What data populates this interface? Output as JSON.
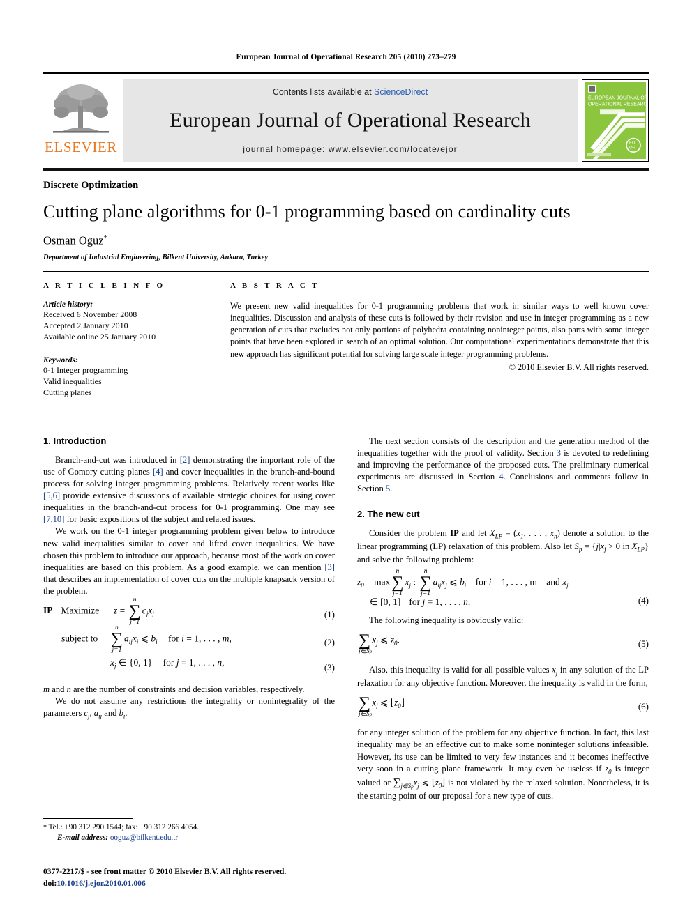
{
  "masthead": {
    "running_head": "European Journal of Operational Research 205 (2010) 273–279"
  },
  "journal_header": {
    "publisher_logo_text": "ELSEVIER",
    "contents_prefix": "Contents lists available at ",
    "contents_link": "ScienceDirect",
    "journal_title": "European Journal of Operational Research",
    "homepage": "journal homepage: www.elsevier.com/locate/ejor",
    "cover_title_line1": "EUROPEAN JOURNAL OF",
    "cover_title_line2": "OPERATIONAL RESEARCH",
    "cover_accent_color": "#8cc63e",
    "link_color": "#2a5db0"
  },
  "article": {
    "section_kind": "Discrete Optimization",
    "title": "Cutting plane algorithms for 0-1 programming based on cardinality cuts",
    "author": "Osman Oguz",
    "author_footnote_marker": "*",
    "affiliation": "Department of Industrial Engineering, Bilkent University, Ankara, Turkey"
  },
  "article_info": {
    "heading": "A R T I C L E    I N F O",
    "history_label": "Article history:",
    "history": [
      "Received 6 November 2008",
      "Accepted 2 January 2010",
      "Available online 25 January 2010"
    ],
    "keywords_label": "Keywords:",
    "keywords": [
      "0-1 Integer programming",
      "Valid inequalities",
      "Cutting planes"
    ]
  },
  "abstract": {
    "heading": "A B S T R A C T",
    "text": "We present new valid inequalities for 0-1 programming problems that work in similar ways to well known cover inequalities. Discussion and analysis of these cuts is followed by their revision and use in integer programming as a new generation of cuts that excludes not only portions of polyhedra containing noninteger points, also parts with some integer points that have been explored in search of an optimal solution. Our computational experimentations demonstrate that this new approach has significant potential for solving large scale integer programming problems.",
    "copyright": "© 2010 Elsevier B.V. All rights reserved."
  },
  "body": {
    "left_column": {
      "section1_heading": "1. Introduction",
      "para1_a": "Branch-and-cut was introduced in ",
      "para1_ref1": "[2]",
      "para1_b": " demonstrating the important role of the use of Gomory cutting planes ",
      "para1_ref2": "[4]",
      "para1_c": " and cover inequalities in the branch-and-bound process for solving integer programming problems. Relatively recent works like ",
      "para1_ref3": "[5,6]",
      "para1_d": " provide extensive discussions of available strategic choices for using cover inequalities in the branch-and-cut process for 0-1 programming. One may see ",
      "para1_ref4": "[7,10]",
      "para1_e": " for basic expositions of the subject and related issues.",
      "para2_a": "We work on the 0-1 integer programming problem given below to introduce new valid inequalities similar to cover and lifted cover inequalities. We have chosen this problem to introduce our approach, because most of the work on cover inequalities are based on this problem. As a good example, we can mention ",
      "para2_ref1": "[3]",
      "para2_b": " that describes an implementation of cover cuts on the multiple knapsack version of the problem.",
      "eq1_label": "IP",
      "eq1_keyword": "Maximize",
      "eq1_number": "(1)",
      "eq2_keyword": "subject to",
      "eq2_number": "(2)",
      "eq3_number": "(3)",
      "para3": "m and n are the number of constraints and decision variables, respectively.",
      "para4": "We do not assume any restrictions the integrality or nonintegrality of the parameters cj, aij and bi."
    },
    "right_column": {
      "para1_a": "The next section consists of the description and the generation method of the inequalities together with the proof of validity. Section ",
      "para1_ref1": "3",
      "para1_b": " is devoted to redefining and improving the performance of the proposed cuts. The preliminary numerical experiments are discussed in Section ",
      "para1_ref2": "4",
      "para1_c": ". Conclusions and comments follow in Section ",
      "para1_ref3": "5",
      "para1_d": ".",
      "section2_heading": "2. The new cut",
      "para2": "Consider the problem IP and let XLP = (x1, . . . , xn) denote a solution to the linear programming (LP) relaxation of this problem. Also let Sp = {j|xj > 0 in XLP} and solve the following problem:",
      "eq4_number": "(4)",
      "para3": "The following inequality is obviously valid:",
      "eq5_number": "(5)",
      "para4": "Also, this inequality is valid for all possible values xj in any solution of the LP relaxation for any objective function. Moreover, the inequality is valid in the form,",
      "eq6_number": "(6)",
      "para5": "for any integer solution of the problem for any objective function. In fact, this last inequality may be an effective cut to make some noninteger solutions infeasible. However, its use can be limited to very few instances and it becomes ineffective very soon in a cutting plane framework. It may even be useless if z0 is integer valued or ∑j∈Sp xj ⩽ ⌊z0⌋ is not violated by the relaxed solution. Nonetheless, it is the starting point of our proposal for a new type of cuts."
    }
  },
  "footer": {
    "footnote_marker": "*",
    "footnote_tel": "Tel.: +90 312 290 1544; fax: +90 312 266 4054.",
    "footnote_email_label": "E-mail address:",
    "footnote_email": "ooguz@bilkent.edu.tr",
    "issn_line": "0377-2217/$ - see front matter © 2010 Elsevier B.V. All rights reserved.",
    "doi_label": "doi:",
    "doi_value": "10.1016/j.ejor.2010.01.006"
  }
}
